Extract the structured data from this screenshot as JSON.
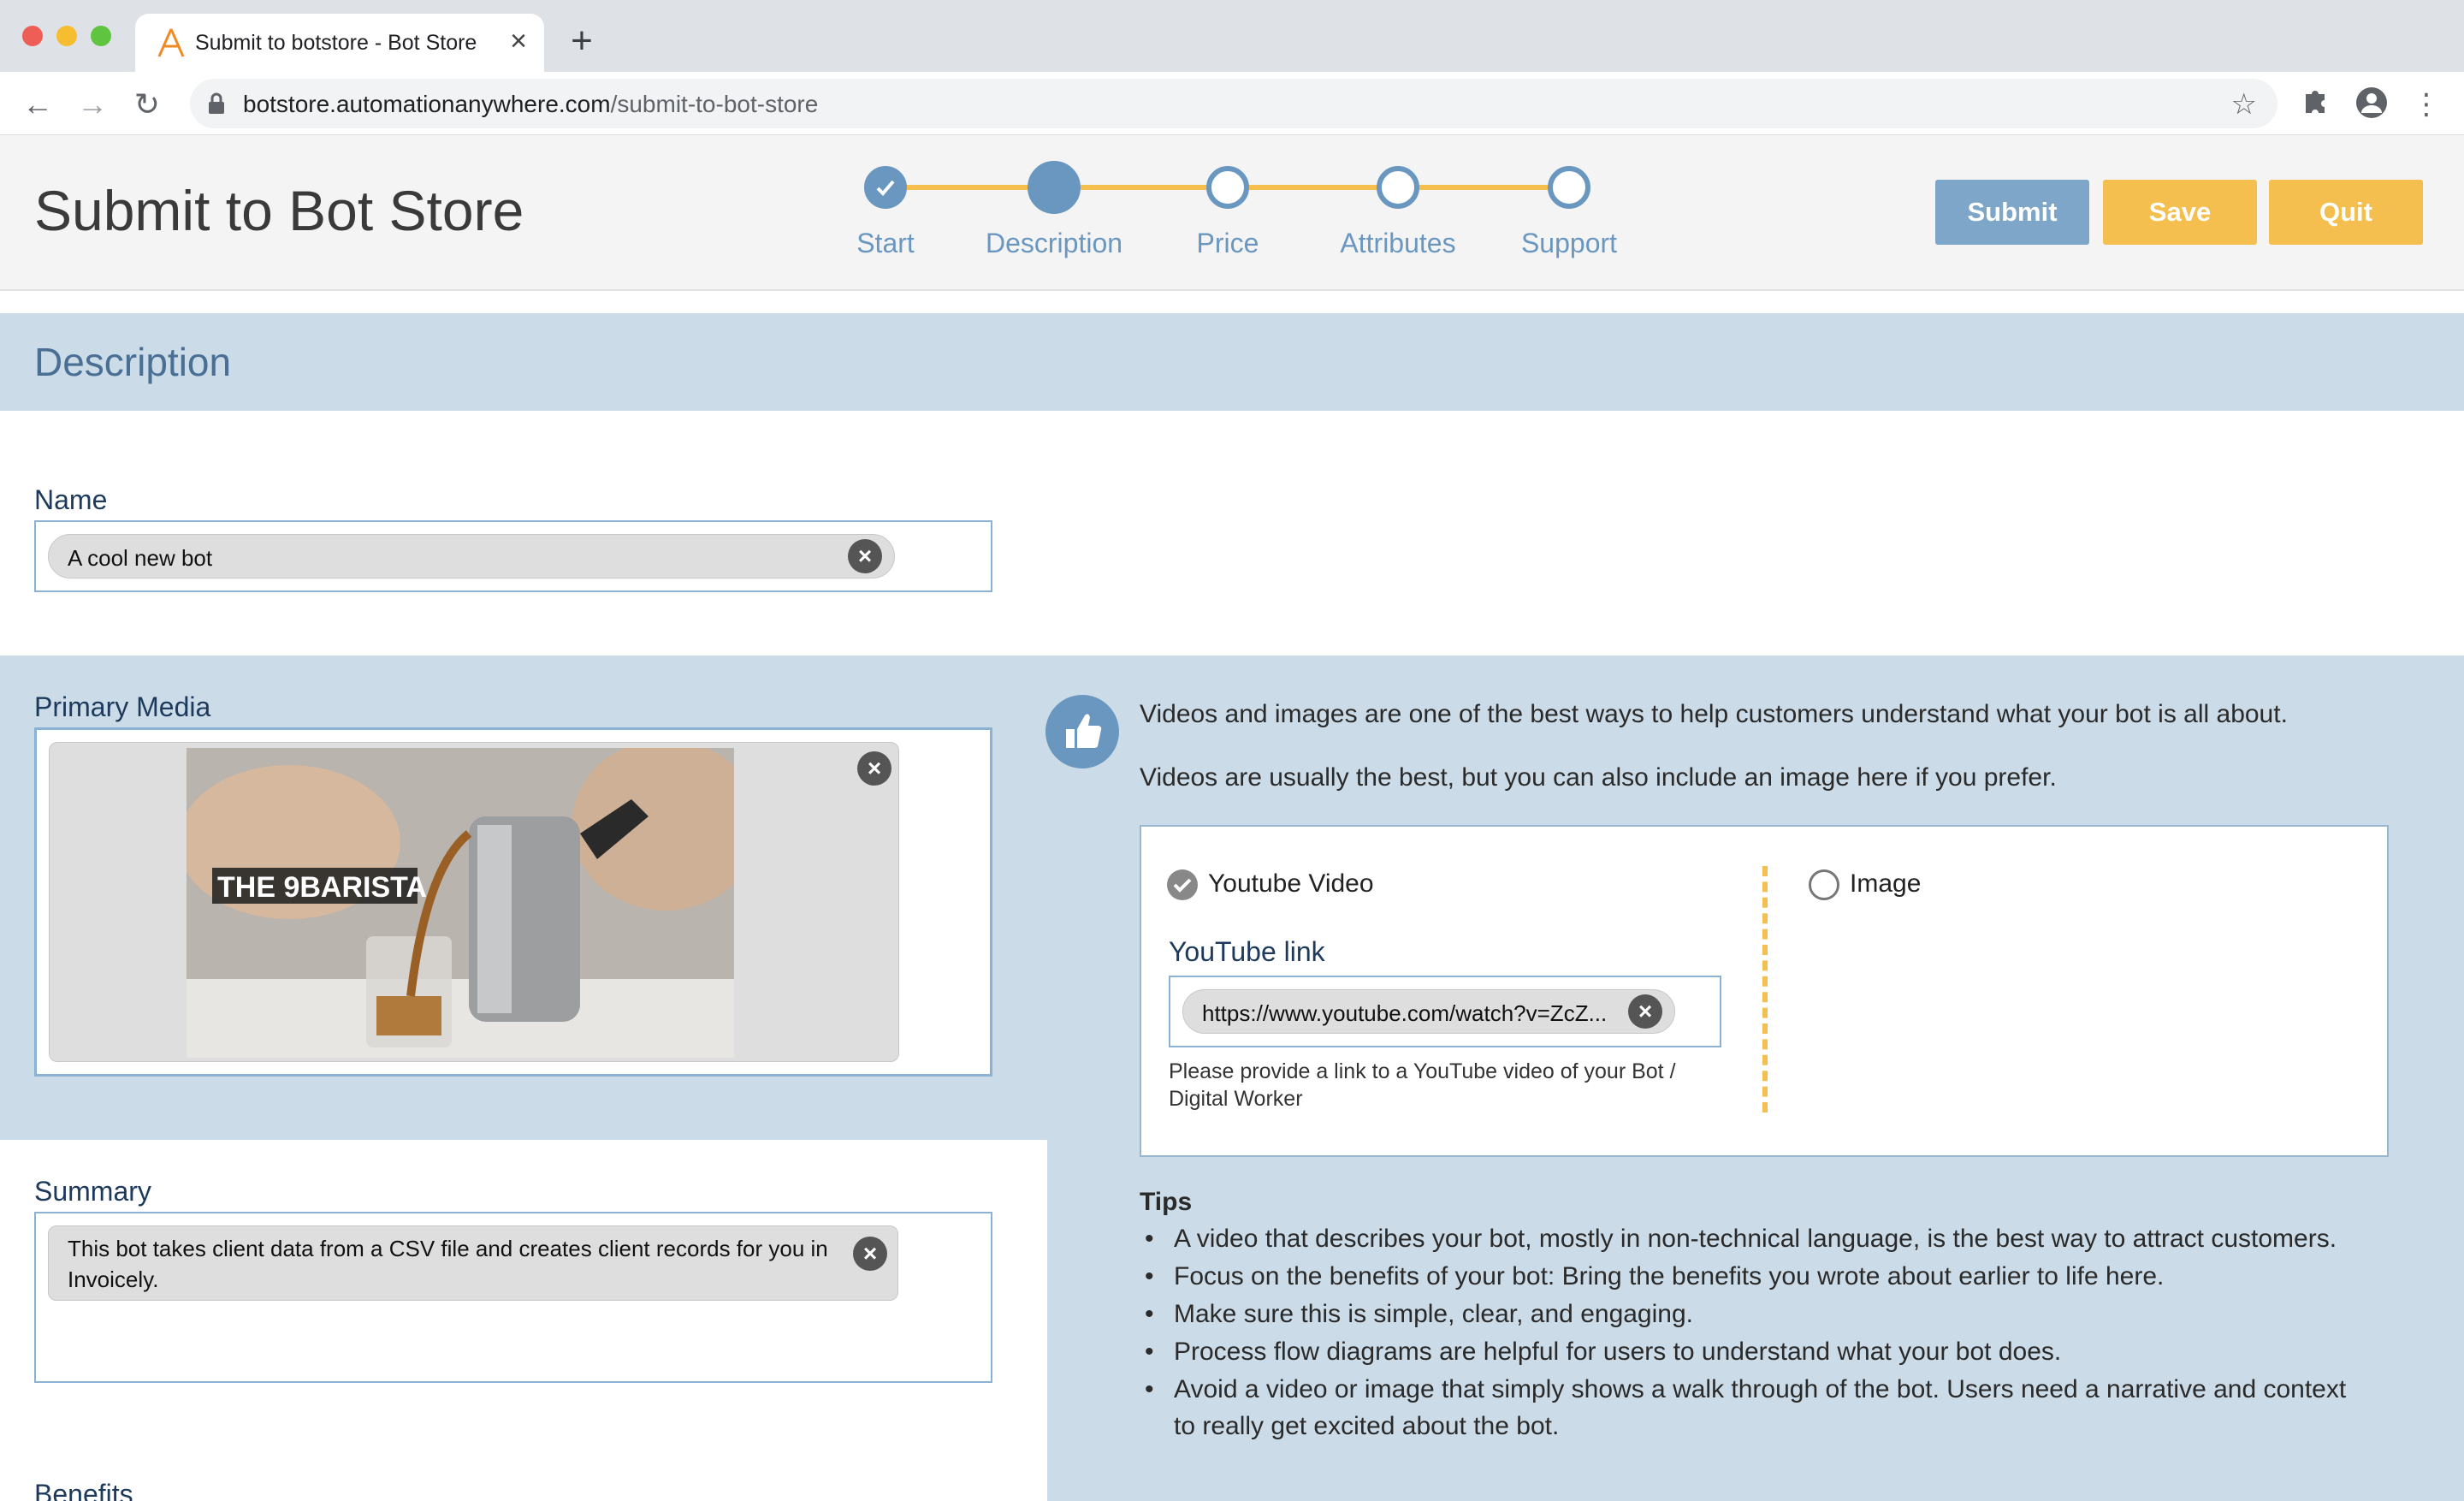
{
  "browser": {
    "tab_title": "Submit to botstore - Bot Store",
    "url_host": "botstore.automationanywhere.com",
    "url_path": "/submit-to-bot-store"
  },
  "header": {
    "title": "Submit to Bot Store",
    "steps": [
      "Start",
      "Description",
      "Price",
      "Attributes",
      "Support"
    ],
    "current_step": 1,
    "submit_label": "Submit",
    "save_label": "Save",
    "quit_label": "Quit",
    "colors": {
      "accent_blue": "#6a97bf",
      "accent_yellow": "#f5bf4f"
    }
  },
  "section": {
    "title": "Description"
  },
  "name_field": {
    "label": "Name",
    "value": "A cool new bot"
  },
  "media": {
    "label": "Primary Media",
    "thumbnail_caption": "THE 9BARISTA"
  },
  "summary_field": {
    "label": "Summary",
    "value_line1": "This bot takes client data from a CSV file and creates client records for you in",
    "value_line2": "Invoicely."
  },
  "benefits_label": "Benefits",
  "media_help": {
    "line1": "Videos and images are one of the best ways to help customers understand what your bot is all about.",
    "line2": "Videos are usually the best, but you can also include an image here if you prefer.",
    "option_video": "Youtube Video",
    "option_image": "Image",
    "selected": "Youtube Video",
    "youtube_label": "YouTube link",
    "youtube_value": "https://www.youtube.com/watch?v=ZcZ...",
    "youtube_hint_line1": "Please provide a link to a YouTube video of your Bot /",
    "youtube_hint_line2": "Digital Worker"
  },
  "tips": {
    "title": "Tips",
    "items": [
      "A video that describes your bot, mostly in non-technical language, is the best way to attract customers.",
      "Focus on the benefits of your bot: Bring the benefits you wrote about earlier to life here.",
      "Make sure this is simple, clear, and engaging.",
      "Process flow diagrams are helpful for users to understand what your bot does.",
      "Avoid a video or image that simply shows a walk through of the bot. Users need a narrative and context",
      "to really get excited about the bot."
    ]
  }
}
